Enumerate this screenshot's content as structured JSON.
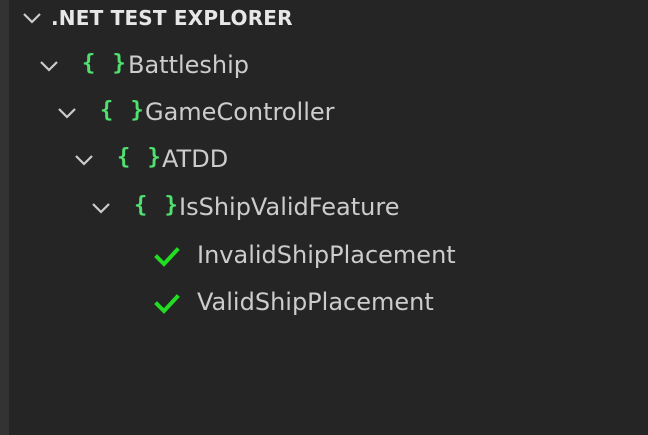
{
  "explorer": {
    "title": ".NET TEST EXPLORER"
  },
  "tree": {
    "battleship": {
      "label": "Battleship",
      "icon": "namespace-braces-icon",
      "icon_text": "{ }"
    },
    "gamecontroller": {
      "label": "GameController",
      "icon": "namespace-braces-icon",
      "icon_text": "{ }"
    },
    "atdd": {
      "label": "ATDD",
      "icon": "namespace-braces-icon",
      "icon_text": "{ }"
    },
    "feature": {
      "label": "IsShipValidFeature",
      "icon": "namespace-braces-icon",
      "icon_text": "{ }"
    },
    "tests": [
      {
        "label": "InvalidShipPlacement",
        "status": "passed",
        "icon": "check-icon"
      },
      {
        "label": "ValidShipPlacement",
        "status": "passed",
        "icon": "check-icon"
      }
    ]
  },
  "colors": {
    "background": "#252526",
    "namespace_icon": "#50e070",
    "pass_icon": "#22dd22",
    "text": "#cccccc"
  }
}
